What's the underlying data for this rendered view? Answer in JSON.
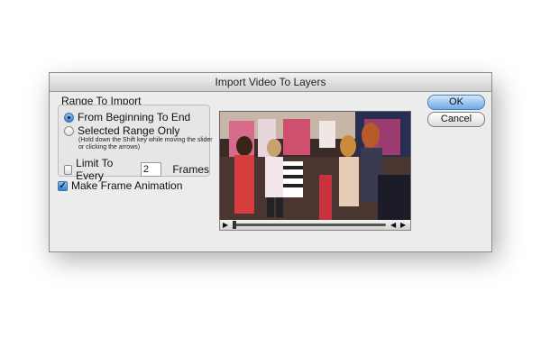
{
  "dialog": {
    "title": "Import Video To Layers",
    "range_group_label": "Range To Import",
    "option_from_beginning": "From Beginning To End",
    "option_selected_range": "Selected Range Only",
    "hint_text": "(Hold down the Shift key while moving the slider or clicking the arrows)",
    "limit_label": "Limit To Every",
    "limit_value": "2",
    "frames_label": "Frames",
    "make_frame_animation_label": "Make Frame Animation",
    "ok_label": "OK",
    "cancel_label": "Cancel",
    "make_frame_animation_checked": true,
    "limit_checked": false,
    "selected_range_option": "from_beginning"
  },
  "video_controls": {
    "play_icon": "play-icon",
    "step_back_icon": "step-back-icon",
    "step_forward_icon": "step-forward-icon",
    "slider_position": 0.05
  },
  "colors": {
    "default_button": "#6ea9e6",
    "dialog_background": "#ececec"
  }
}
